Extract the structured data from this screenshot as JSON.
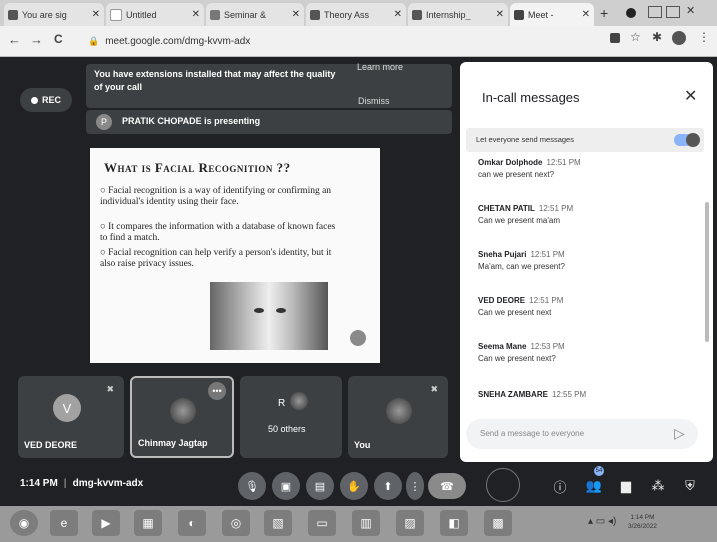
{
  "browser": {
    "tabs": [
      {
        "title": "You are sig",
        "active": false
      },
      {
        "title": "Untitled",
        "active": false
      },
      {
        "title": "Seminar & ",
        "active": false
      },
      {
        "title": "Theory Ass",
        "active": false
      },
      {
        "title": "Internship_",
        "active": false
      },
      {
        "title": "Meet -",
        "active": true
      }
    ],
    "new_tab": "+",
    "url": "meet.google.com/dmg-kvvm-adx",
    "nav": {
      "back": "←",
      "forward": "→",
      "reload": "C"
    }
  },
  "meet": {
    "rec_label": "REC",
    "extension_warning": "You have extensions installed that may affect the quality of your call",
    "learn_more": "Learn more",
    "dismiss": "Dismiss",
    "presenter_initial": "P",
    "presenting": "PRATIK CHOPADE is presenting",
    "slide": {
      "title": "What is Facial Recognition ??",
      "bullets": [
        "Facial recognition is a way of identifying or confirming an individual's identity using their face.",
        "It compares the information with a database of known faces to find a match.",
        "Facial recognition can help verify a person's identity, but it also raise privacy issues."
      ]
    },
    "tiles": [
      {
        "name": "VED DEORE",
        "initial": "V"
      },
      {
        "name": "Chinmay Jagtap"
      },
      {
        "name": "50 others",
        "initial": "R"
      },
      {
        "name": "You"
      }
    ],
    "clock": "1:14 PM",
    "meeting_code": "dmg-kvvm-adx",
    "people_count": "54"
  },
  "panel": {
    "title": "In-call messages",
    "toggle_label": "Let everyone send messages",
    "toggle_on": true,
    "messages": [
      {
        "name": "Omkar Dolphode",
        "time": "12:51 PM",
        "text": "can we present next?"
      },
      {
        "name": "CHETAN PATIL",
        "time": "12:51 PM",
        "text": "Can we present ma'am"
      },
      {
        "name": "Sneha Pujari",
        "time": "12:51 PM",
        "text": "Ma'am, can we present?"
      },
      {
        "name": "VED DEORE",
        "time": "12:51 PM",
        "text": "Can we present next"
      },
      {
        "name": "Seema Mane",
        "time": "12:53 PM",
        "text": "Can we present next?"
      },
      {
        "name": "SNEHA ZAMBARE",
        "time": "12:55 PM",
        "text": ""
      }
    ],
    "input_placeholder": "Send a message to everyone"
  },
  "taskbar": {
    "time": "1:14 PM",
    "date": "3/26/2022"
  }
}
